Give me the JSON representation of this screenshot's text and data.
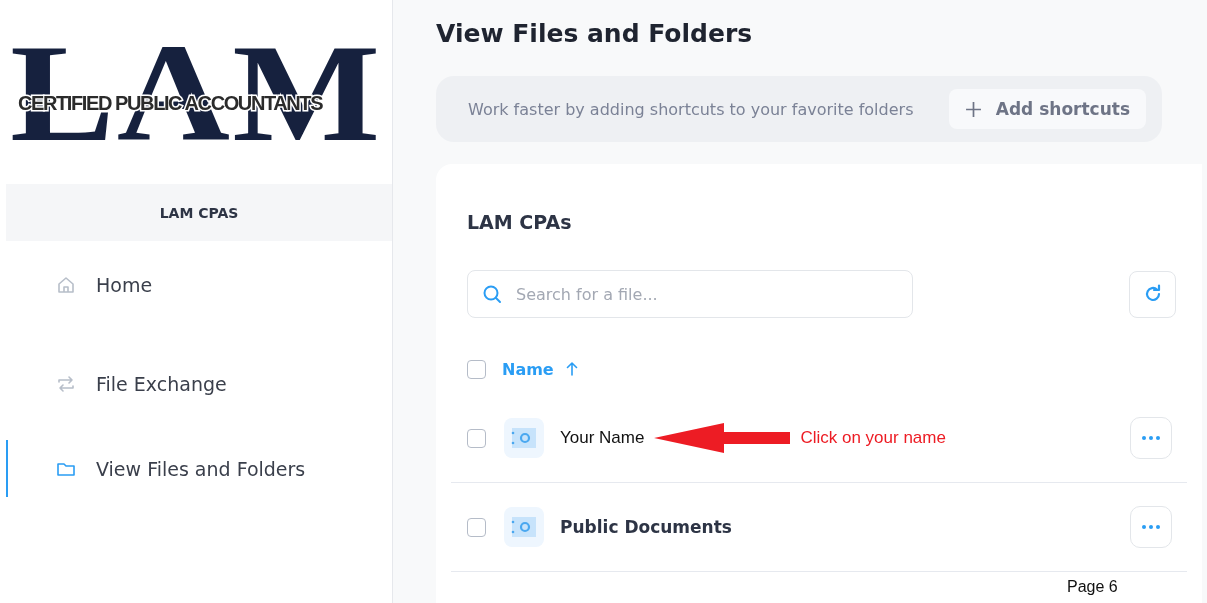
{
  "logo": {
    "monogram": "LAM",
    "tagline": "CERTIFIED PUBLIC ACCOUNTANTS"
  },
  "org_name": "LAM CPAS",
  "nav": [
    {
      "label": "Home",
      "selected": false
    },
    {
      "label": "File Exchange",
      "selected": false
    },
    {
      "label": "View Files and Folders",
      "selected": true
    }
  ],
  "page_title": "View Files and Folders",
  "shortcuts": {
    "message": "Work faster by adding shortcuts to your favorite folders",
    "button": "Add shortcuts"
  },
  "card": {
    "title": "LAM CPAs",
    "search": {
      "placeholder": "Search for a file..."
    },
    "select_all": {
      "checked": false
    },
    "column": {
      "label": "Name",
      "sort_ascending": true
    },
    "rows": [
      {
        "name": "Your Name",
        "checked": false,
        "annotation": "Click on your name"
      },
      {
        "name": "Public Documents",
        "checked": false
      }
    ]
  },
  "page_number": "Page 6"
}
